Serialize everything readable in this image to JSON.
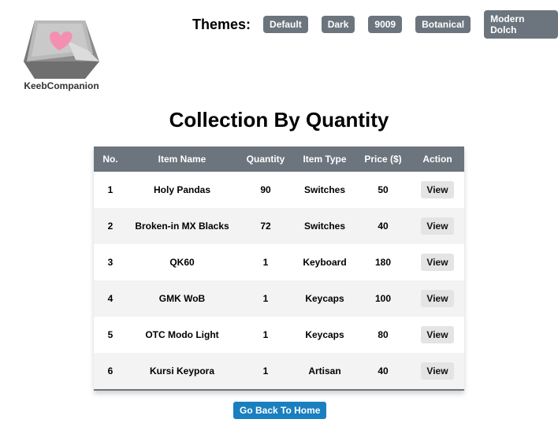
{
  "logo": {
    "text": "KeebCompanion",
    "heart_color": "#f48fb1"
  },
  "themes": {
    "label": "Themes:",
    "options": [
      "Default",
      "Dark",
      "9009",
      "Botanical",
      "Modern Dolch"
    ]
  },
  "page_title": "Collection By Quantity",
  "table": {
    "headers": [
      "No.",
      "Item Name",
      "Quantity",
      "Item Type",
      "Price ($)",
      "Action"
    ],
    "rows": [
      {
        "no": "1",
        "name": "Holy Pandas",
        "quantity": "90",
        "type": "Switches",
        "price": "50",
        "action": "View"
      },
      {
        "no": "2",
        "name": "Broken-in MX Blacks",
        "quantity": "72",
        "type": "Switches",
        "price": "40",
        "action": "View"
      },
      {
        "no": "3",
        "name": "QK60",
        "quantity": "1",
        "type": "Keyboard",
        "price": "180",
        "action": "View"
      },
      {
        "no": "4",
        "name": "GMK WoB",
        "quantity": "1",
        "type": "Keycaps",
        "price": "100",
        "action": "View"
      },
      {
        "no": "5",
        "name": "OTC Modo Light",
        "quantity": "1",
        "type": "Keycaps",
        "price": "80",
        "action": "View"
      },
      {
        "no": "6",
        "name": "Kursi Keypora",
        "quantity": "1",
        "type": "Artisan",
        "price": "40",
        "action": "View"
      }
    ]
  },
  "home_button": "Go Back To Home",
  "colors": {
    "header_bg": "#6c757d",
    "primary": "#1a7fbf"
  }
}
